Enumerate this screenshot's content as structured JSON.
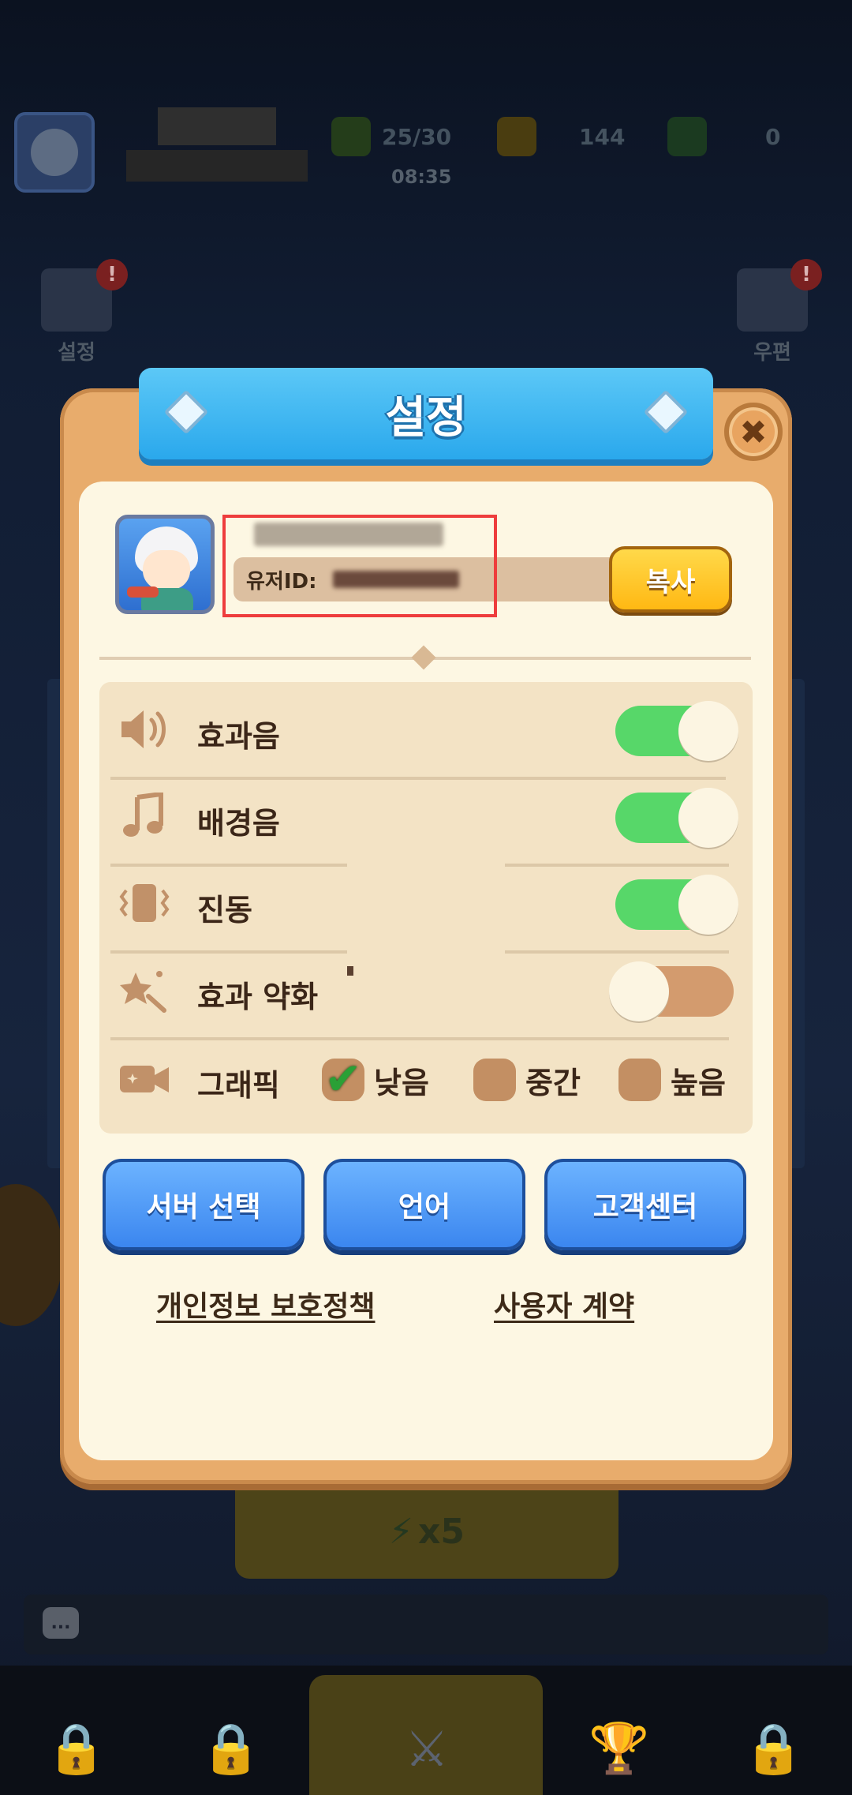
{
  "background": {
    "stamina": "25/30",
    "timer": "08:35",
    "gold": "144",
    "gems": "0",
    "left_menu_label": "설정",
    "right_menu_label": "우편",
    "alert_badge": "!",
    "cost_label": "x5",
    "chat_icon": "...",
    "bottom_nav": [
      "lock-icon",
      "lock-icon",
      "battle-icon",
      "trophy-icon",
      "lock-icon"
    ]
  },
  "dialog": {
    "title": "설정",
    "close_label": "✖",
    "profile": {
      "user_id_label": "유저ID:",
      "copy_button": "복사"
    },
    "settings": [
      {
        "icon": "speaker-icon",
        "label": "효과음",
        "toggle": true
      },
      {
        "icon": "music-note-icon",
        "label": "배경음",
        "toggle": true
      },
      {
        "icon": "vibration-icon",
        "label": "진동",
        "toggle": true
      },
      {
        "icon": "sparkle-icon",
        "label": "효과 약화",
        "toggle": false
      }
    ],
    "graphics": {
      "label": "그래픽",
      "options": [
        {
          "label": "낮음",
          "checked": true
        },
        {
          "label": "중간",
          "checked": false
        },
        {
          "label": "높음",
          "checked": false
        }
      ]
    },
    "buttons": {
      "server_select": "서버 선택",
      "language": "언어",
      "customer_center": "고객센터"
    },
    "links": {
      "privacy_policy": "개인정보 보호정책",
      "terms_of_use": "사용자 계약"
    }
  },
  "colors": {
    "toggle_on": "#57d769",
    "toggle_off": "#d39b6e",
    "title_ribbon": "#2aa8ec",
    "dialog_frame": "#e8ac6c",
    "highlight": "#ee3d3d"
  }
}
